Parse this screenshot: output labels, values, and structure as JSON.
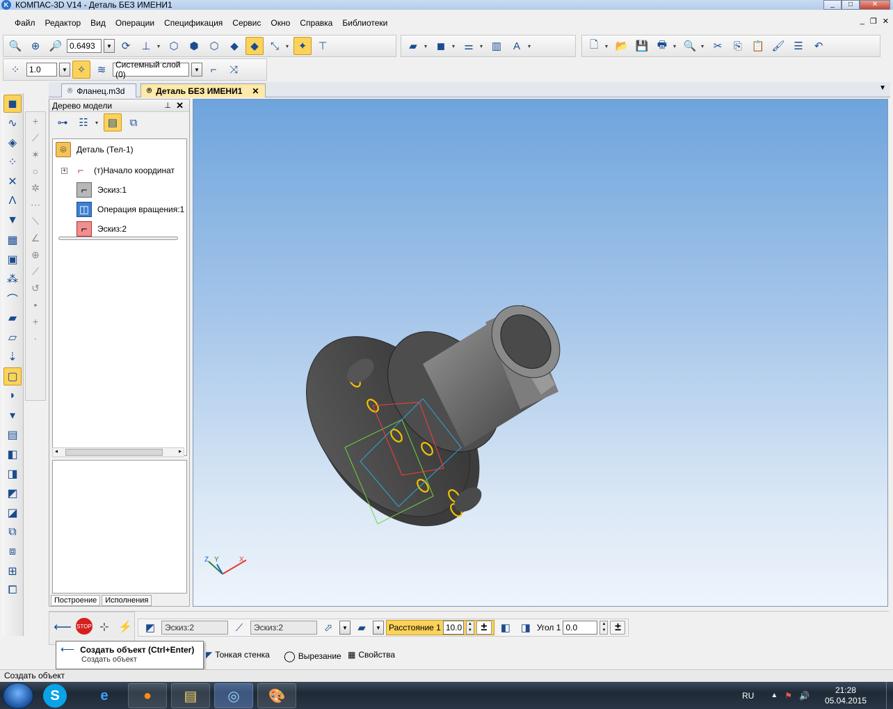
{
  "window": {
    "title": "КОМПАС-3D V14 - Деталь БЕЗ ИМЕНИ1"
  },
  "menu": [
    "Файл",
    "Редактор",
    "Вид",
    "Операции",
    "Спецификация",
    "Сервис",
    "Окно",
    "Справка",
    "Библиотеки"
  ],
  "toolbar": {
    "zoom_value": "0.6493",
    "line_scale": "1.0",
    "layer": "Системный слой (0)"
  },
  "doc_tabs": [
    {
      "label": "Фланец.m3d",
      "active": false
    },
    {
      "label": "Деталь БЕЗ ИМЕНИ1",
      "active": true
    }
  ],
  "tree_panel": {
    "title": "Дерево модели",
    "nodes": [
      {
        "label": "Деталь (Тел-1)",
        "icon": "part-icon"
      },
      {
        "label": "(т)Начало координат",
        "icon": "origin-icon"
      },
      {
        "label": "Эскиз:1",
        "icon": "sketch-icon"
      },
      {
        "label": "Операция вращения:1",
        "icon": "rotation-operation-icon"
      },
      {
        "label": "Эскиз:2",
        "icon": "sketch-active-icon"
      }
    ],
    "bottom_tabs": [
      "Построение",
      "Исполнения"
    ]
  },
  "axes": {
    "x": "X",
    "y": "Y",
    "z": "Z"
  },
  "properties": {
    "sketch1": "Эскиз:2",
    "sketch2": "Эскиз:2",
    "distance_label": "Расстояние 1",
    "distance_value": "10.0",
    "angle_label": "Угол 1",
    "angle_value": "0.0"
  },
  "property_tabs": [
    "Тонкая стенка",
    "Вырезание",
    "Свойства"
  ],
  "tooltip": {
    "title": "Создать объект (Ctrl+Enter)",
    "subtitle": "Создать объект"
  },
  "status": "Создать объект",
  "taskbar": {
    "lang": "RU",
    "time": "21:28",
    "date": "05.04.2015"
  },
  "colors": {
    "accent": "#fbd25a",
    "viewport_top": "#6ea4dd",
    "viewport_bottom": "#eef4fb"
  }
}
